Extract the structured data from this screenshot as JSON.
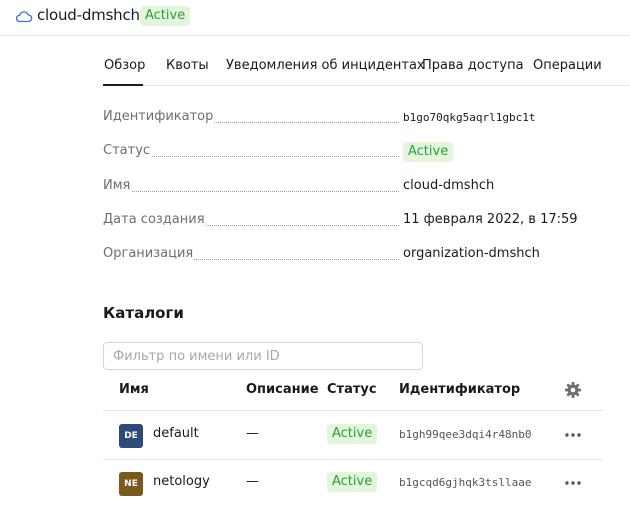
{
  "header": {
    "title": "cloud-dmshch",
    "status": "Active",
    "icon": "cloud-icon"
  },
  "tabs": [
    {
      "label": "Обзор",
      "active": true
    },
    {
      "label": "Квоты",
      "active": false
    },
    {
      "label": "Уведомления об инцидентах",
      "active": false
    },
    {
      "label": "Права доступа",
      "active": false
    },
    {
      "label": "Операции",
      "active": false
    }
  ],
  "overview": {
    "id_label": "Идентификатор",
    "id_value": "b1go70qkg5aqrl1gbc1t",
    "status_label": "Статус",
    "status_value": "Active",
    "name_label": "Имя",
    "name_value": "cloud-dmshch",
    "created_label": "Дата создания",
    "created_value": "11 февраля 2022, в 17:59",
    "org_label": "Организация",
    "org_value": "organization-dmshch"
  },
  "catalogs": {
    "title": "Каталоги",
    "filter_placeholder": "Фильтр по имени или ID",
    "columns": {
      "name": "Имя",
      "description": "Описание",
      "status": "Статус",
      "id": "Идентификатор"
    },
    "settings_icon": "gear-icon",
    "rows": [
      {
        "avatar": "DE",
        "avatar_color": "#2e4a78",
        "name": "default",
        "description": "—",
        "status": "Active",
        "id": "b1gh99qee3dqi4r48nb0",
        "menu_icon": "more-icon"
      },
      {
        "avatar": "NE",
        "avatar_color": "#7a5a1c",
        "name": "netology",
        "description": "—",
        "status": "Active",
        "id": "b1gcqd6gjhqk3tsllaae",
        "menu_icon": "more-icon"
      }
    ]
  },
  "colors": {
    "status_bg": "#e3f6dc",
    "status_text": "#2c9d3a",
    "accent": "#1a1a1a"
  }
}
